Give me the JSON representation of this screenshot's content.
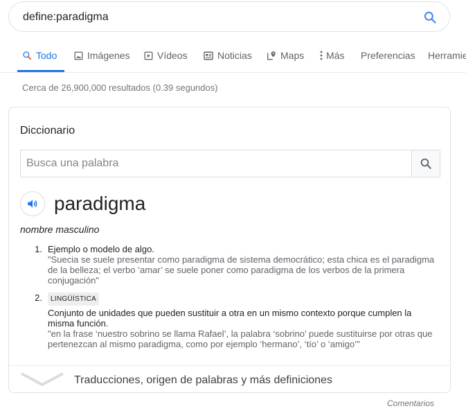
{
  "search": {
    "query": "define:paradigma"
  },
  "tabs": [
    {
      "label": "Todo",
      "icon": "search-icon"
    },
    {
      "label": "Imágenes",
      "icon": "image-icon"
    },
    {
      "label": "Vídeos",
      "icon": "video-icon"
    },
    {
      "label": "Noticias",
      "icon": "news-icon"
    },
    {
      "label": "Maps",
      "icon": "map-pin-icon"
    },
    {
      "label": "Más",
      "icon": "more-vert-icon"
    },
    {
      "label": "Preferencias"
    },
    {
      "label": "Herramientas"
    }
  ],
  "stats": "Cerca de 26,900,000 resultados (0.39 segundos)",
  "dictionary": {
    "title": "Diccionario",
    "search_placeholder": "Busca una palabra",
    "word": "paradigma",
    "part_of_speech": "nombre masculino",
    "senses": [
      {
        "number": "1.",
        "definition": "Ejemplo o modelo de algo.",
        "example": "\"Suecia se suele presentar como paradigma de sistema democrático; esta chica es el paradigma de la belleza; el verbo ‘amar’ se suele poner como paradigma de los verbos de la primera conjugación\""
      },
      {
        "number": "2.",
        "tag": "LINGÜÍSTICA",
        "definition": "Conjunto de unidades que pueden sustituir a otra en un mismo contexto porque cumplen la misma función.",
        "example": "\"en la frase ‘nuestro sobrino se llama Rafael’, la palabra ‘sobrino’ puede sustituirse por otras que pertenezcan al mismo paradigma, como por ejemplo ‘hermano’, ‘tío’ o ‘amigo’\""
      }
    ],
    "more_label": "Traducciones, origen de palabras y más definiciones"
  },
  "feedback": "Comentarios",
  "colors": {
    "accent": "#1a73e8",
    "text": "#202124",
    "muted": "#70757a"
  }
}
